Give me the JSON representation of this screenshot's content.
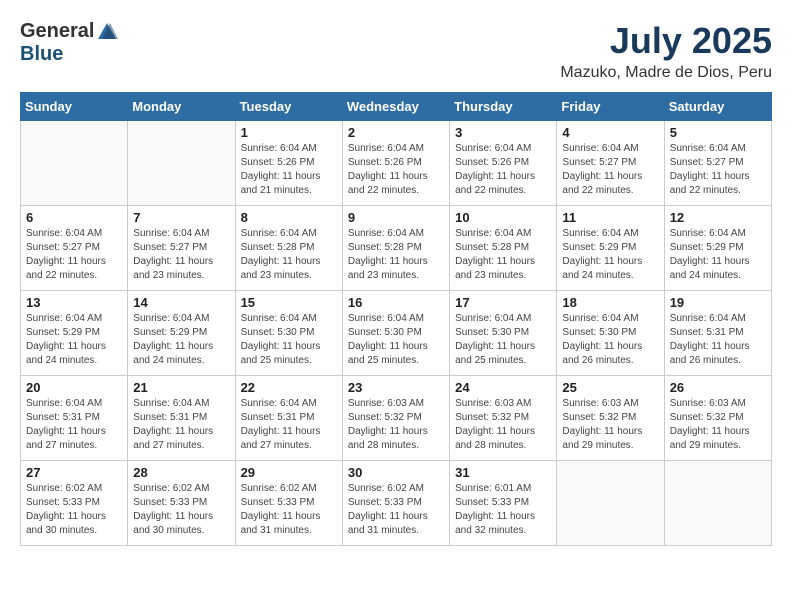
{
  "header": {
    "logo_general": "General",
    "logo_blue": "Blue",
    "month_year": "July 2025",
    "location": "Mazuko, Madre de Dios, Peru"
  },
  "days_of_week": [
    "Sunday",
    "Monday",
    "Tuesday",
    "Wednesday",
    "Thursday",
    "Friday",
    "Saturday"
  ],
  "weeks": [
    [
      {
        "day": "",
        "info": ""
      },
      {
        "day": "",
        "info": ""
      },
      {
        "day": "1",
        "info": "Sunrise: 6:04 AM\nSunset: 5:26 PM\nDaylight: 11 hours and 21 minutes."
      },
      {
        "day": "2",
        "info": "Sunrise: 6:04 AM\nSunset: 5:26 PM\nDaylight: 11 hours and 22 minutes."
      },
      {
        "day": "3",
        "info": "Sunrise: 6:04 AM\nSunset: 5:26 PM\nDaylight: 11 hours and 22 minutes."
      },
      {
        "day": "4",
        "info": "Sunrise: 6:04 AM\nSunset: 5:27 PM\nDaylight: 11 hours and 22 minutes."
      },
      {
        "day": "5",
        "info": "Sunrise: 6:04 AM\nSunset: 5:27 PM\nDaylight: 11 hours and 22 minutes."
      }
    ],
    [
      {
        "day": "6",
        "info": "Sunrise: 6:04 AM\nSunset: 5:27 PM\nDaylight: 11 hours and 22 minutes."
      },
      {
        "day": "7",
        "info": "Sunrise: 6:04 AM\nSunset: 5:27 PM\nDaylight: 11 hours and 23 minutes."
      },
      {
        "day": "8",
        "info": "Sunrise: 6:04 AM\nSunset: 5:28 PM\nDaylight: 11 hours and 23 minutes."
      },
      {
        "day": "9",
        "info": "Sunrise: 6:04 AM\nSunset: 5:28 PM\nDaylight: 11 hours and 23 minutes."
      },
      {
        "day": "10",
        "info": "Sunrise: 6:04 AM\nSunset: 5:28 PM\nDaylight: 11 hours and 23 minutes."
      },
      {
        "day": "11",
        "info": "Sunrise: 6:04 AM\nSunset: 5:29 PM\nDaylight: 11 hours and 24 minutes."
      },
      {
        "day": "12",
        "info": "Sunrise: 6:04 AM\nSunset: 5:29 PM\nDaylight: 11 hours and 24 minutes."
      }
    ],
    [
      {
        "day": "13",
        "info": "Sunrise: 6:04 AM\nSunset: 5:29 PM\nDaylight: 11 hours and 24 minutes."
      },
      {
        "day": "14",
        "info": "Sunrise: 6:04 AM\nSunset: 5:29 PM\nDaylight: 11 hours and 24 minutes."
      },
      {
        "day": "15",
        "info": "Sunrise: 6:04 AM\nSunset: 5:30 PM\nDaylight: 11 hours and 25 minutes."
      },
      {
        "day": "16",
        "info": "Sunrise: 6:04 AM\nSunset: 5:30 PM\nDaylight: 11 hours and 25 minutes."
      },
      {
        "day": "17",
        "info": "Sunrise: 6:04 AM\nSunset: 5:30 PM\nDaylight: 11 hours and 25 minutes."
      },
      {
        "day": "18",
        "info": "Sunrise: 6:04 AM\nSunset: 5:30 PM\nDaylight: 11 hours and 26 minutes."
      },
      {
        "day": "19",
        "info": "Sunrise: 6:04 AM\nSunset: 5:31 PM\nDaylight: 11 hours and 26 minutes."
      }
    ],
    [
      {
        "day": "20",
        "info": "Sunrise: 6:04 AM\nSunset: 5:31 PM\nDaylight: 11 hours and 27 minutes."
      },
      {
        "day": "21",
        "info": "Sunrise: 6:04 AM\nSunset: 5:31 PM\nDaylight: 11 hours and 27 minutes."
      },
      {
        "day": "22",
        "info": "Sunrise: 6:04 AM\nSunset: 5:31 PM\nDaylight: 11 hours and 27 minutes."
      },
      {
        "day": "23",
        "info": "Sunrise: 6:03 AM\nSunset: 5:32 PM\nDaylight: 11 hours and 28 minutes."
      },
      {
        "day": "24",
        "info": "Sunrise: 6:03 AM\nSunset: 5:32 PM\nDaylight: 11 hours and 28 minutes."
      },
      {
        "day": "25",
        "info": "Sunrise: 6:03 AM\nSunset: 5:32 PM\nDaylight: 11 hours and 29 minutes."
      },
      {
        "day": "26",
        "info": "Sunrise: 6:03 AM\nSunset: 5:32 PM\nDaylight: 11 hours and 29 minutes."
      }
    ],
    [
      {
        "day": "27",
        "info": "Sunrise: 6:02 AM\nSunset: 5:33 PM\nDaylight: 11 hours and 30 minutes."
      },
      {
        "day": "28",
        "info": "Sunrise: 6:02 AM\nSunset: 5:33 PM\nDaylight: 11 hours and 30 minutes."
      },
      {
        "day": "29",
        "info": "Sunrise: 6:02 AM\nSunset: 5:33 PM\nDaylight: 11 hours and 31 minutes."
      },
      {
        "day": "30",
        "info": "Sunrise: 6:02 AM\nSunset: 5:33 PM\nDaylight: 11 hours and 31 minutes."
      },
      {
        "day": "31",
        "info": "Sunrise: 6:01 AM\nSunset: 5:33 PM\nDaylight: 11 hours and 32 minutes."
      },
      {
        "day": "",
        "info": ""
      },
      {
        "day": "",
        "info": ""
      }
    ]
  ]
}
